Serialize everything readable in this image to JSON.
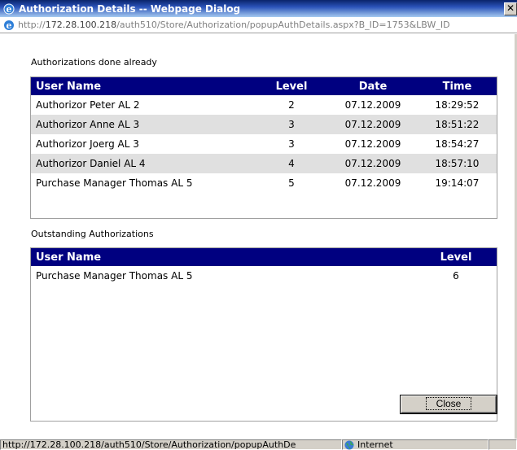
{
  "window": {
    "title": "Authorization Details -- Webpage Dialog",
    "close_glyph": "✕"
  },
  "address": {
    "scheme": "http://",
    "host": "172.28.100.218",
    "path": "/auth510/Store/Authorization/popupAuthDetails.aspx?B_ID=1753&LBW_ID"
  },
  "done": {
    "label": "Authorizations done already",
    "columns": [
      "User Name",
      "Level",
      "Date",
      "Time"
    ],
    "rows": [
      {
        "user": "Authorizor Peter AL 2",
        "level": "2",
        "date": "07.12.2009",
        "time": "18:29:52"
      },
      {
        "user": "Authorizor Anne AL 3",
        "level": "3",
        "date": "07.12.2009",
        "time": "18:51:22"
      },
      {
        "user": "Authorizor Joerg AL 3",
        "level": "3",
        "date": "07.12.2009",
        "time": "18:54:27"
      },
      {
        "user": "Authorizor Daniel AL 4",
        "level": "4",
        "date": "07.12.2009",
        "time": "18:57:10"
      },
      {
        "user": "Purchase Manager Thomas AL 5",
        "level": "5",
        "date": "07.12.2009",
        "time": "19:14:07"
      }
    ]
  },
  "outstanding": {
    "label": "Outstanding Authorizations",
    "columns": [
      "User Name",
      "Level"
    ],
    "rows": [
      {
        "user": "Purchase Manager Thomas AL 5",
        "level": "6"
      }
    ]
  },
  "close_button": {
    "label": "Close"
  },
  "status": {
    "url": "http://172.28.100.218/auth510/Store/Authorization/popupAuthDe",
    "zone": "Internet"
  },
  "colors": {
    "header_bg": "#000080",
    "alt_row": "#e0e0e0",
    "chrome": "#d4d0c8"
  },
  "icons": {
    "browser": "ie-icon",
    "zone": "globe-icon"
  }
}
